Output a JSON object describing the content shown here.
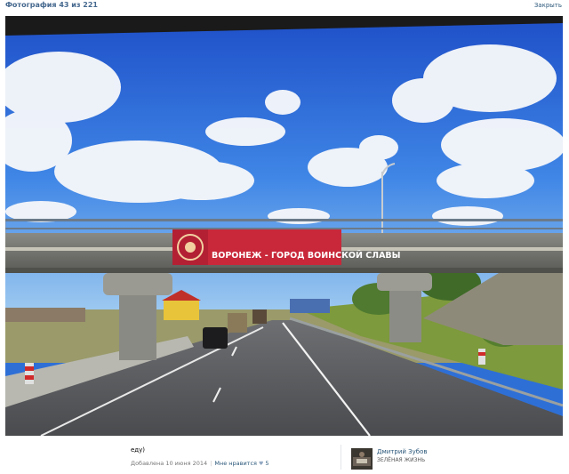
{
  "header": {
    "counter_text": "Фотография 43 из 221",
    "close_label": "Закрыть"
  },
  "photo": {
    "banner_text": "ВОРОНЕЖ - ГОРОД ВОИНСКОЙ СЛАВЫ",
    "icon": "photo-image"
  },
  "footer": {
    "caption": "еду)",
    "added_text": "Добавлена 10 июня 2014",
    "separator": "|",
    "like_label": "Мне нравится",
    "like_icon": "heart-icon",
    "like_count": "5"
  },
  "author": {
    "name": "Дмитрий Зубов",
    "status": "ЗЕЛЁНАЯ ЖИЗНЬ"
  },
  "colors": {
    "link": "#2b587a",
    "header_link": "#45688e",
    "meta": "#777777",
    "banner_red": "#c8283a"
  }
}
